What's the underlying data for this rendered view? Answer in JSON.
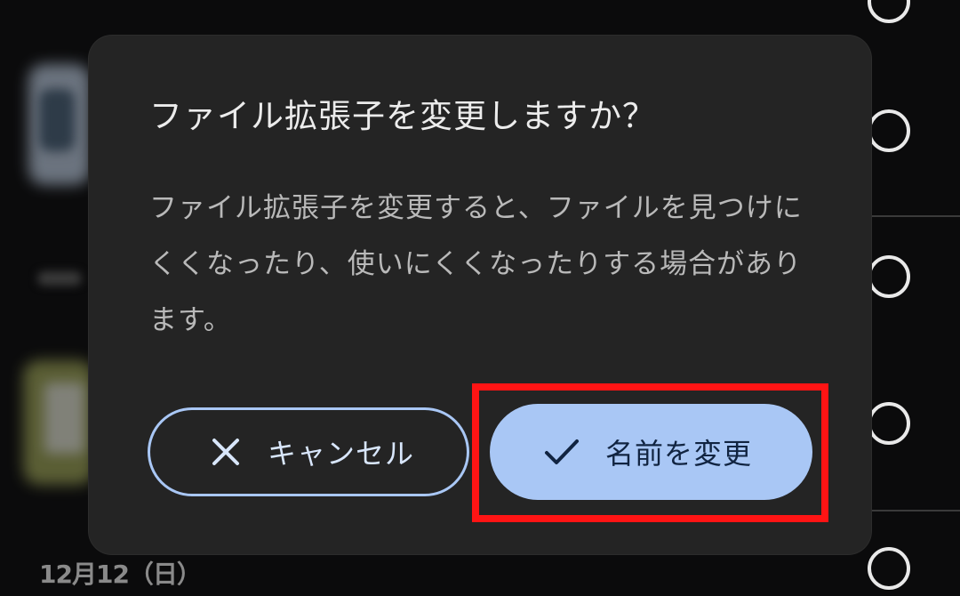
{
  "background": {
    "date_label": "12月12（日）"
  },
  "dialog": {
    "title": "ファイル拡張子を変更しますか？",
    "body": "ファイル拡張子を変更すると、ファイルを見つけにくくなったり、使いにくくなったりする場合があります。",
    "cancel_label": "キャンセル",
    "confirm_label": "名前を変更",
    "cancel_icon": "close-icon",
    "confirm_icon": "check-icon"
  },
  "colors": {
    "dialog_bg": "#242424",
    "accent": "#a9c7f5",
    "highlight": "#ff1414"
  }
}
